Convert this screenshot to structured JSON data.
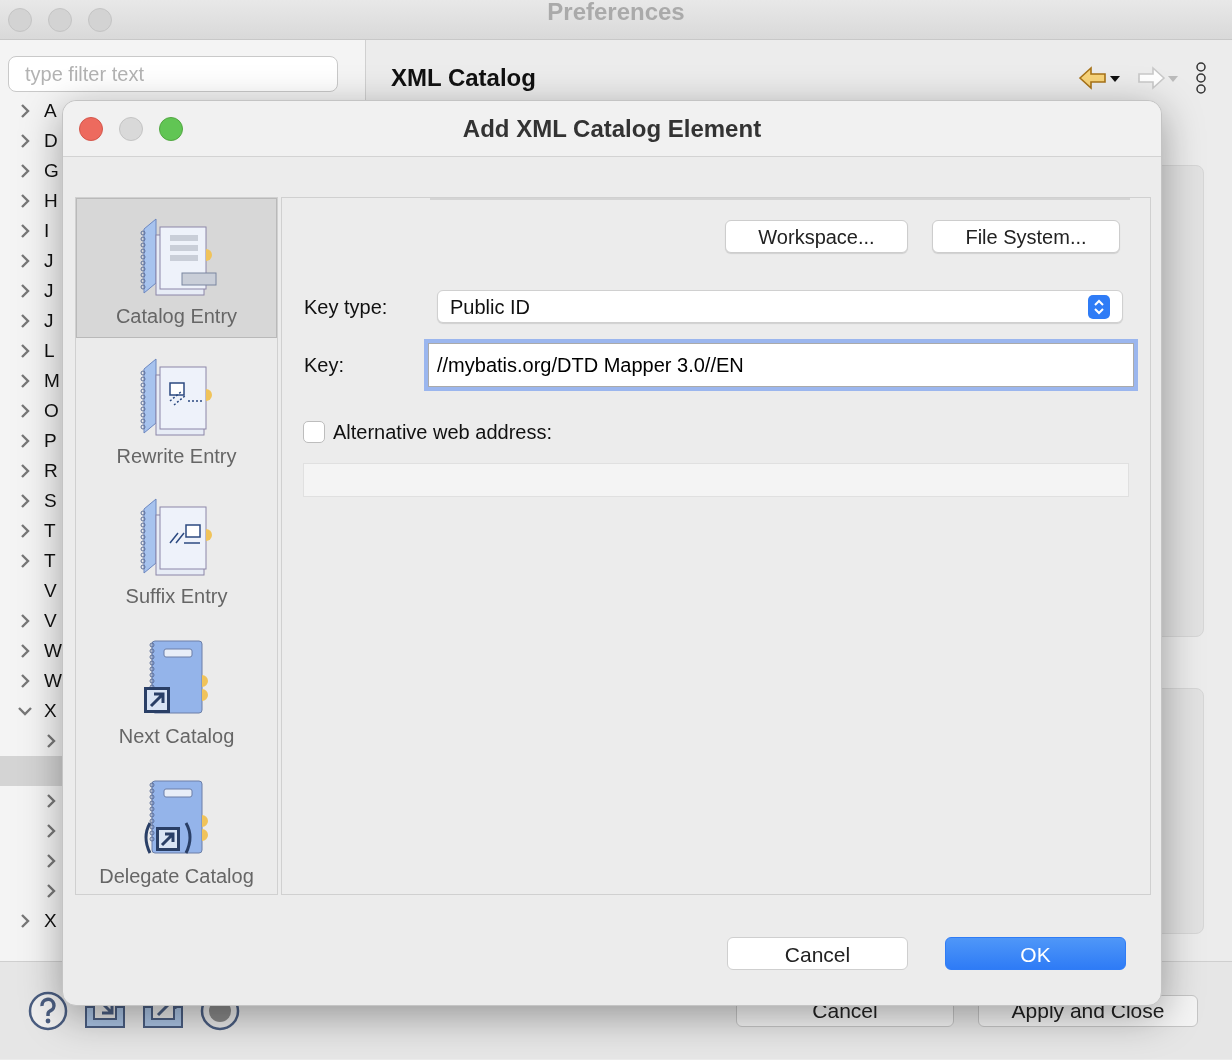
{
  "window": {
    "title": "Preferences"
  },
  "filter": {
    "placeholder": "type filter text"
  },
  "tree": [
    {
      "label": "A",
      "expanded": false,
      "selected": false
    },
    {
      "label": "D",
      "expanded": false,
      "selected": false
    },
    {
      "label": "G",
      "expanded": false,
      "selected": false
    },
    {
      "label": "H",
      "expanded": false,
      "selected": false
    },
    {
      "label": "I",
      "expanded": false,
      "selected": false
    },
    {
      "label": "J",
      "expanded": false,
      "selected": false
    },
    {
      "label": "J",
      "expanded": false,
      "selected": false
    },
    {
      "label": "J",
      "expanded": false,
      "selected": false
    },
    {
      "label": "L",
      "expanded": false,
      "selected": false
    },
    {
      "label": "M",
      "expanded": false,
      "selected": false
    },
    {
      "label": "O",
      "expanded": false,
      "selected": false
    },
    {
      "label": "P",
      "expanded": false,
      "selected": false
    },
    {
      "label": "R",
      "expanded": false,
      "selected": false
    },
    {
      "label": "S",
      "expanded": false,
      "selected": false
    },
    {
      "label": "T",
      "expanded": false,
      "selected": false
    },
    {
      "label": "T",
      "expanded": false,
      "selected": false
    },
    {
      "label": "V",
      "selected": false
    },
    {
      "label": "V",
      "expanded": false,
      "selected": false
    },
    {
      "label": "W",
      "expanded": false,
      "selected": false
    },
    {
      "label": "W",
      "expanded": false,
      "selected": false
    },
    {
      "label": "X",
      "expanded": true,
      "selected": false,
      "children": [
        {
          "expanded": false,
          "selected": false
        },
        {
          "selected": true
        },
        {
          "expanded": false,
          "selected": false
        },
        {
          "expanded": false,
          "selected": false
        },
        {
          "expanded": false,
          "selected": false
        },
        {
          "expanded": false,
          "selected": false
        }
      ]
    },
    {
      "label": "X",
      "expanded": false,
      "selected": false
    }
  ],
  "page": {
    "title": "XML Catalog"
  },
  "footer_buttons": [
    "Cancel",
    "Apply and Close"
  ],
  "dialog": {
    "title": "Add XML Catalog Element",
    "entry_types": [
      {
        "label": "Catalog Entry",
        "selected": true,
        "kind": "catalog"
      },
      {
        "label": "Rewrite Entry",
        "selected": false,
        "kind": "rewrite"
      },
      {
        "label": "Suffix Entry",
        "selected": false,
        "kind": "suffix"
      },
      {
        "label": "Next Catalog",
        "selected": false,
        "kind": "next"
      },
      {
        "label": "Delegate Catalog",
        "selected": false,
        "kind": "delegate"
      }
    ],
    "browse_buttons": [
      "Workspace...",
      "File System..."
    ],
    "key_type": {
      "label": "Key type:",
      "value": "Public ID"
    },
    "key": {
      "label": "Key:",
      "value": "//mybatis.org/DTD Mapper 3.0//EN",
      "focused": true
    },
    "alternative": {
      "label": "Alternative web address:",
      "checked": false
    },
    "buttons": [
      {
        "label": "Cancel",
        "kind": "secondary"
      },
      {
        "label": "OK",
        "kind": "primary"
      }
    ]
  }
}
